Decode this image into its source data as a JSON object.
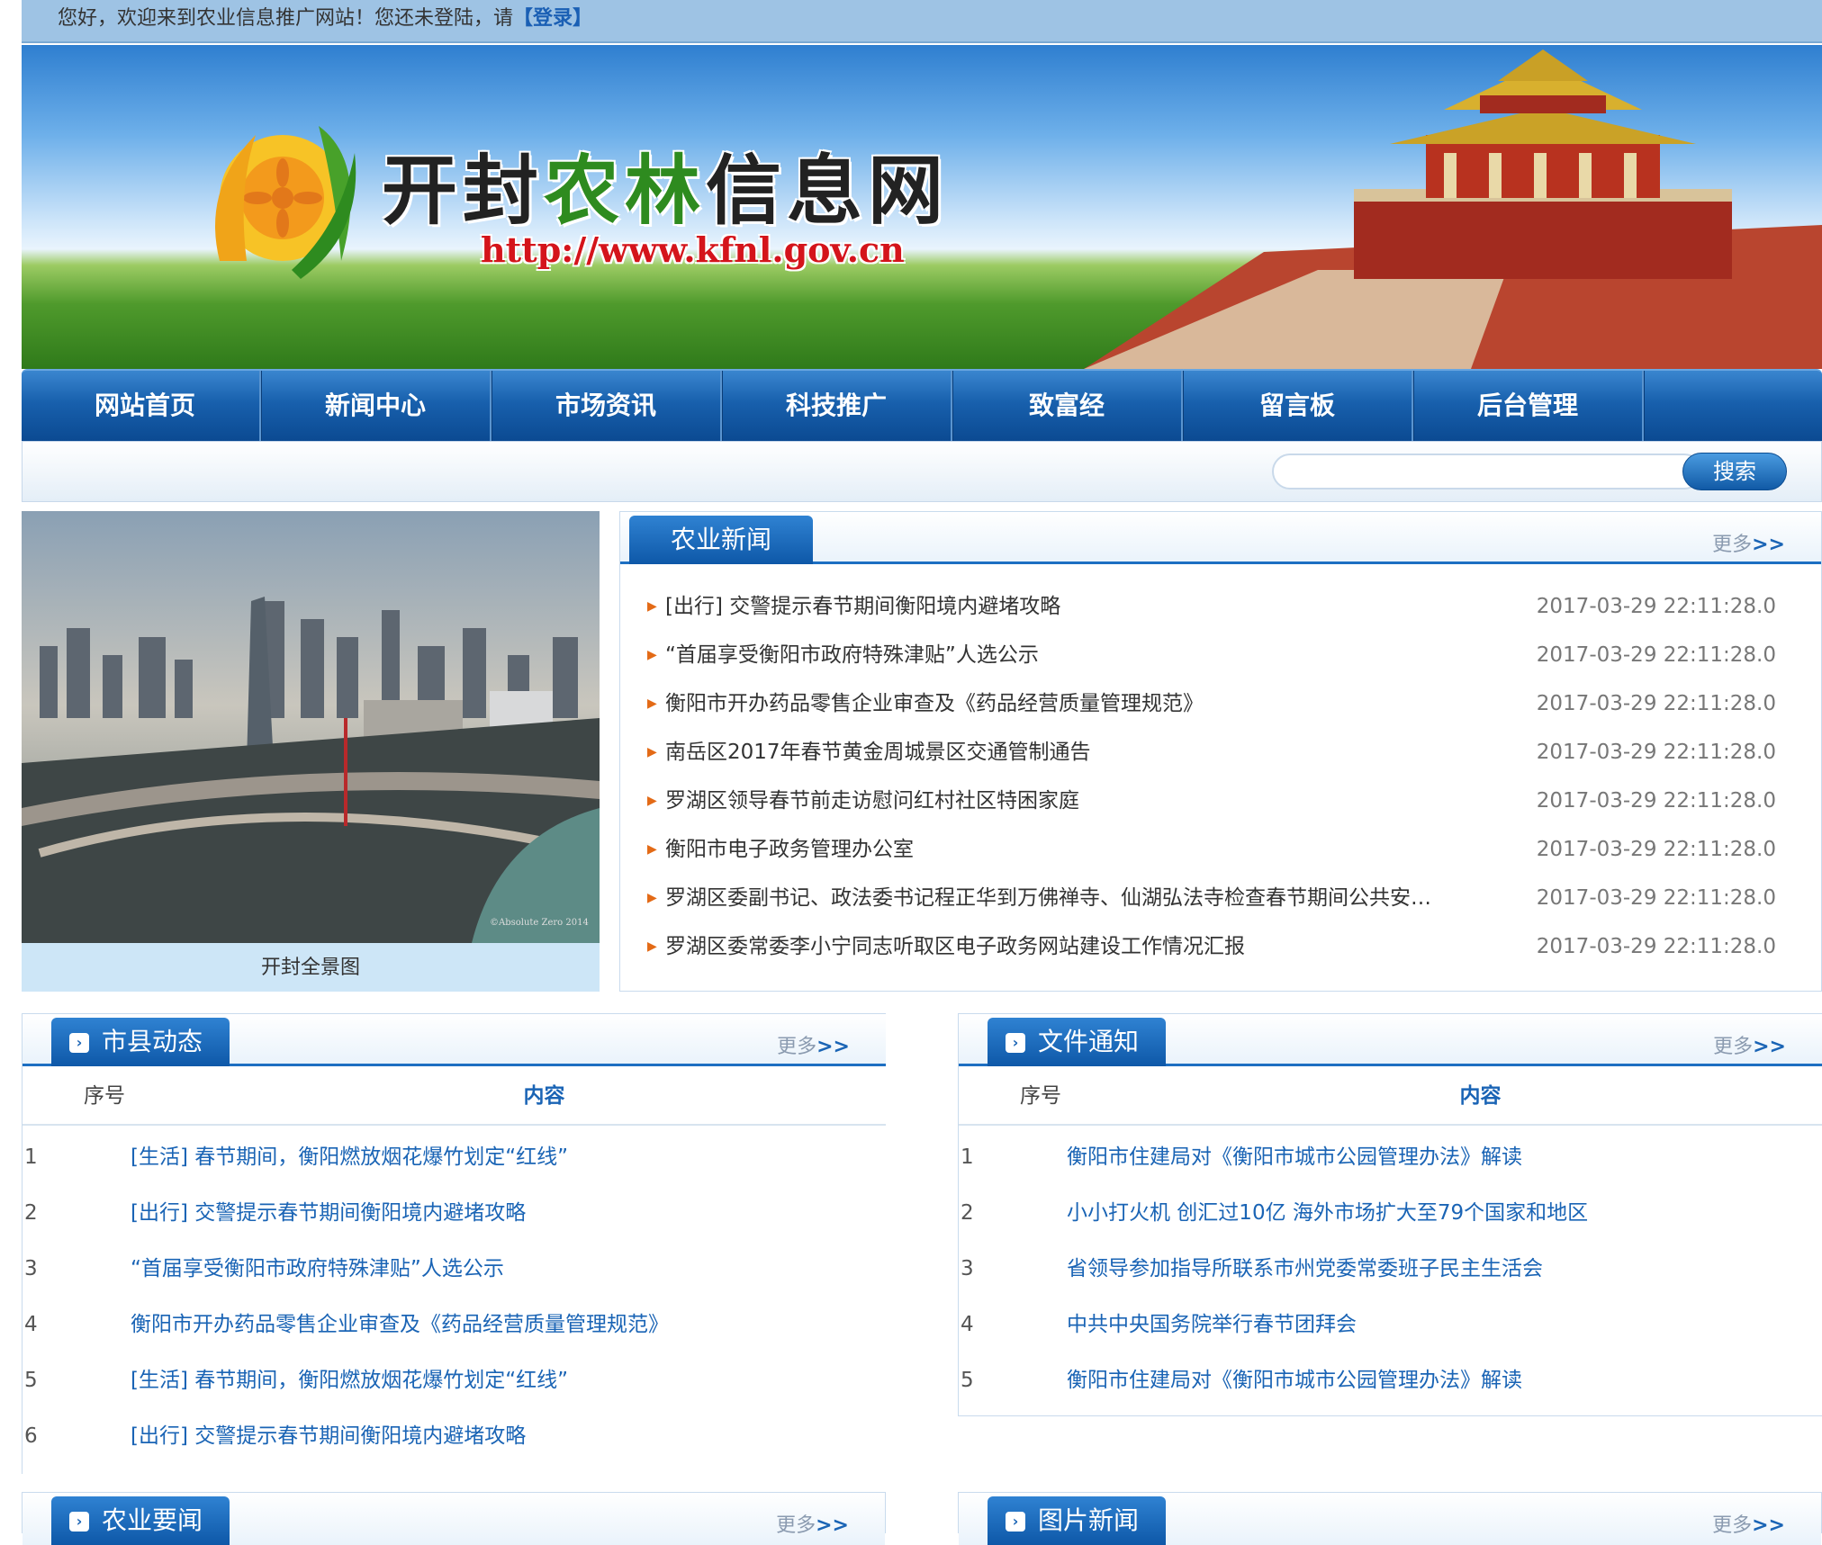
{
  "topbar": {
    "welcome": "您好，欢迎来到农业信息推广网站！您还未登陆，请",
    "login": "【登录】"
  },
  "banner": {
    "title_a": "开封",
    "title_b": "农林",
    "title_c": "信息网",
    "url": "http://www.kfnl.gov.cn"
  },
  "nav": [
    "网站首页",
    "新闻中心",
    "市场资讯",
    "科技推广",
    "致富经",
    "留言板",
    "后台管理"
  ],
  "search": {
    "button": "搜索",
    "value": ""
  },
  "photo": {
    "caption": "开封全景图",
    "watermark": "©Absolute Zero 2014"
  },
  "agri_news": {
    "title": "农业新闻",
    "more": "更多",
    "more_arrow": ">>",
    "items": [
      {
        "title": "[出行] 交警提示春节期间衡阳境内避堵攻略",
        "date": "2017-03-29 22:11:28.0"
      },
      {
        "title": "“首届享受衡阳市政府特殊津贴”人选公示",
        "date": "2017-03-29 22:11:28.0"
      },
      {
        "title": "衡阳市开办药品零售企业审查及《药品经营质量管理规范》",
        "date": "2017-03-29 22:11:28.0"
      },
      {
        "title": "南岳区2017年春节黄金周城景区交通管制通告",
        "date": "2017-03-29 22:11:28.0"
      },
      {
        "title": "罗湖区领导春节前走访慰问红村社区特困家庭",
        "date": "2017-03-29 22:11:28.0"
      },
      {
        "title": "衡阳市电子政务管理办公室",
        "date": "2017-03-29 22:11:28.0"
      },
      {
        "title": "罗湖区委副书记、政法委书记程正华到万佛禅寺、仙湖弘法寺检查春节期间公共安…",
        "date": "2017-03-29 22:11:28.0"
      },
      {
        "title": "罗湖区委常委李小宁同志听取区电子政务网站建设工作情况汇报",
        "date": "2017-03-29 22:11:28.0"
      }
    ]
  },
  "county": {
    "title": "市县动态",
    "more": "更多",
    "more_arrow": ">>",
    "col_no": "序号",
    "col_content": "内容",
    "rows": [
      {
        "no": "1",
        "title": "[生活] 春节期间，衡阳燃放烟花爆竹划定“红线”"
      },
      {
        "no": "2",
        "title": "[出行] 交警提示春节期间衡阳境内避堵攻略"
      },
      {
        "no": "3",
        "title": "“首届享受衡阳市政府特殊津贴”人选公示"
      },
      {
        "no": "4",
        "title": "衡阳市开办药品零售企业审查及《药品经营质量管理规范》"
      },
      {
        "no": "5",
        "title": "[生活] 春节期间，衡阳燃放烟花爆竹划定“红线”"
      },
      {
        "no": "6",
        "title": "[出行] 交警提示春节期间衡阳境内避堵攻略"
      }
    ]
  },
  "notice": {
    "title": "文件通知",
    "more": "更多",
    "more_arrow": ">>",
    "col_no": "序号",
    "col_content": "内容",
    "rows": [
      {
        "no": "1",
        "title": "衡阳市住建局对《衡阳市城市公园管理办法》解读"
      },
      {
        "no": "2",
        "title": "小小打火机 创汇过10亿 海外市场扩大至79个国家和地区"
      },
      {
        "no": "3",
        "title": "省领导参加指导所联系市州党委常委班子民主生活会"
      },
      {
        "no": "4",
        "title": "中共中央国务院举行春节团拜会"
      },
      {
        "no": "5",
        "title": "衡阳市住建局对《衡阳市城市公园管理办法》解读"
      }
    ]
  },
  "agri_key": {
    "title": "农业要闻",
    "more": "更多",
    "more_arrow": ">>"
  },
  "pic_news": {
    "title": "图片新闻",
    "more": "更多",
    "more_arrow": ">>"
  },
  "colors": {
    "nav_blue": "#1860ad",
    "link_blue": "#1a64b5",
    "accent_orange": "#e36a16",
    "url_red": "#d4141b"
  }
}
